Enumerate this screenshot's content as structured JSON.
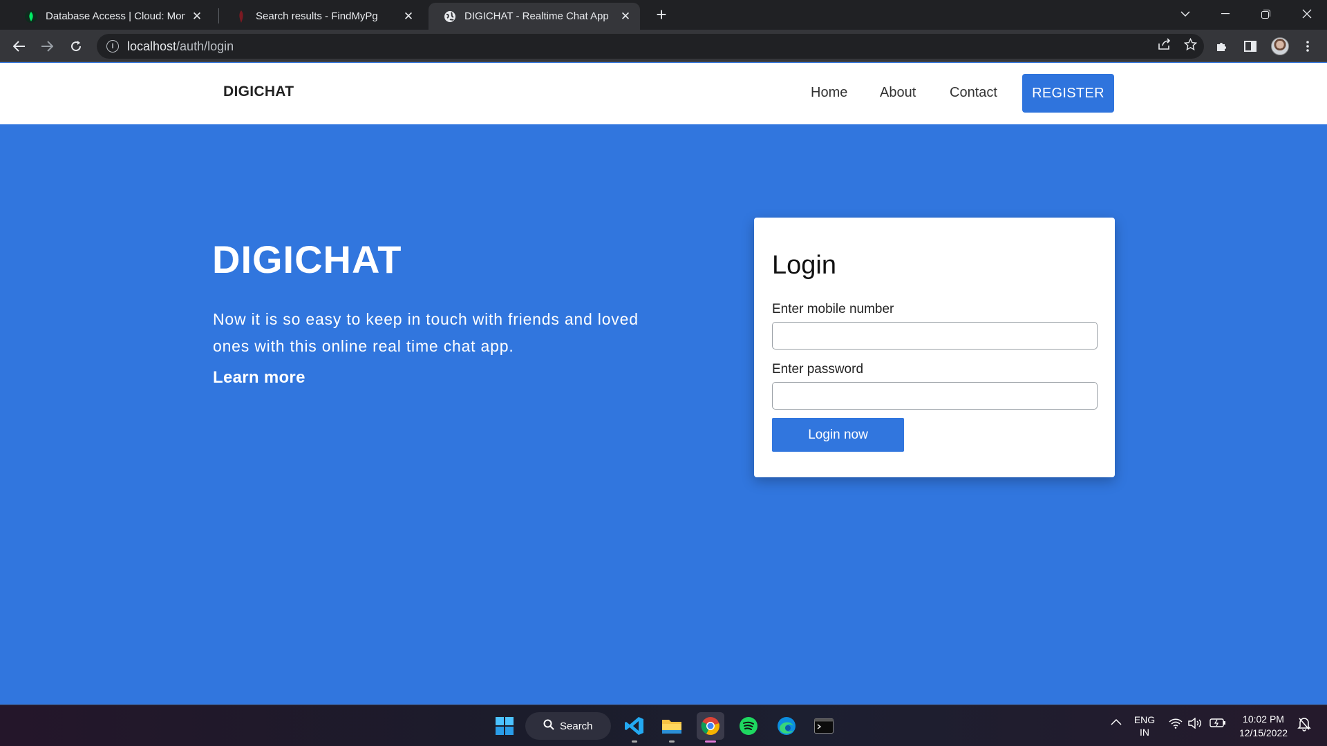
{
  "browser": {
    "tabs": [
      {
        "title": "Database Access | Cloud: MongoDB",
        "favicon": "mongodb-leaf-icon",
        "active": false
      },
      {
        "title": "Search results - FindMyPg",
        "favicon": "findmypg-icon",
        "active": false
      },
      {
        "title": "DIGICHAT - Realtime Chat App",
        "favicon": "globe-icon",
        "active": true
      }
    ],
    "url_host": "localhost",
    "url_path": "/auth/login"
  },
  "site": {
    "brand": "DIGICHAT",
    "nav": {
      "home": "Home",
      "about": "About",
      "contact": "Contact",
      "register": "REGISTER"
    },
    "hero": {
      "title": "DIGICHAT",
      "text": "Now it is so easy to keep in touch with friends and loved ones with this online real time chat app.",
      "learn_more": "Learn more"
    },
    "login": {
      "title": "Login",
      "mobile_label": "Enter mobile number",
      "mobile_value": "",
      "password_label": "Enter password",
      "password_value": "",
      "submit": "Login now"
    },
    "colors": {
      "primary": "#3176de",
      "nav_bg": "#ffffff"
    }
  },
  "taskbar": {
    "search_label": "Search",
    "language": "ENG",
    "region": "IN",
    "time": "10:02 PM",
    "date": "12/15/2022"
  }
}
